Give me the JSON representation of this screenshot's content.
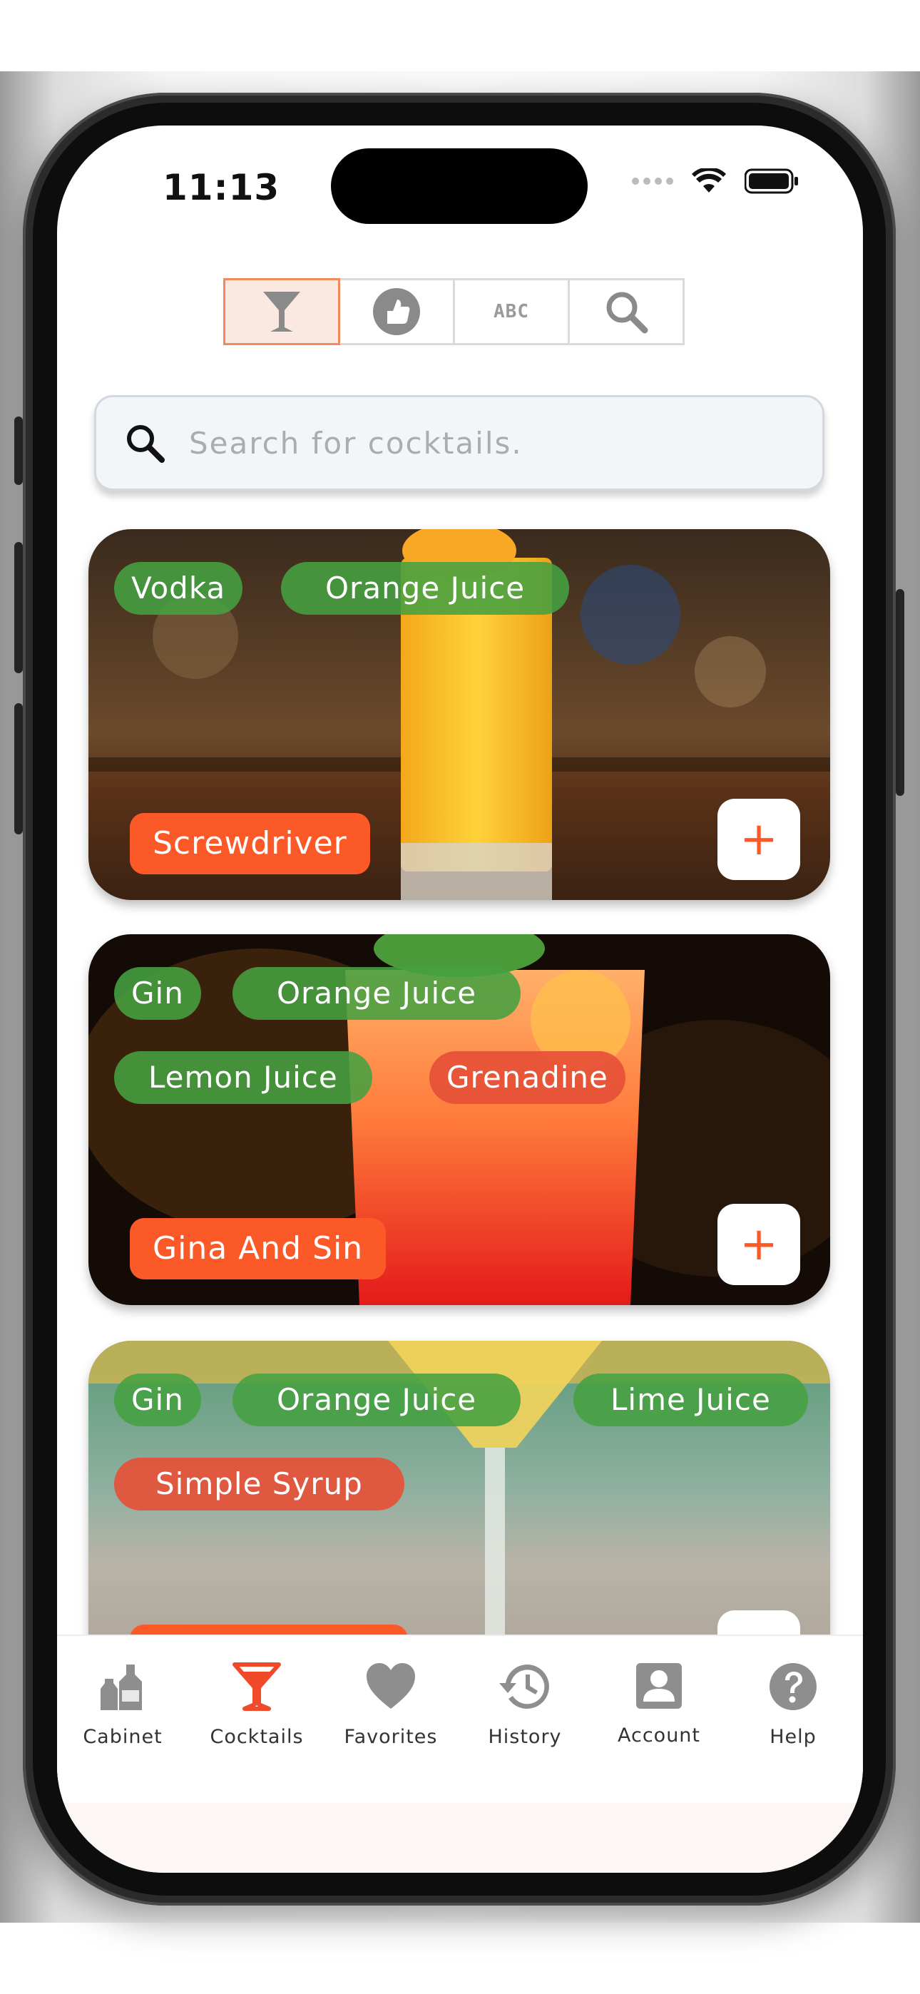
{
  "status": {
    "time": "11:13"
  },
  "segments": [
    {
      "name": "cocktail-filter",
      "icon": "cocktail-icon",
      "active": true
    },
    {
      "name": "favorites-filter",
      "icon": "thumb-icon",
      "active": false
    },
    {
      "name": "alpha-filter",
      "icon": "abc-icon",
      "label": "ABC",
      "active": false
    },
    {
      "name": "search-filter",
      "icon": "search-icon",
      "active": false
    }
  ],
  "search": {
    "placeholder": "Search for cocktails.",
    "value": ""
  },
  "cards": [
    {
      "name": "Screwdriver",
      "ingredients": [
        "Vodka",
        "Orange Juice"
      ],
      "add_label": "+"
    },
    {
      "name": "Gina And Sin",
      "ingredients": [
        "Gin",
        "Orange Juice",
        "Lemon Juice",
        "Grenadine"
      ],
      "add_label": "+"
    },
    {
      "name": "",
      "ingredients": [
        "Gin",
        "Orange Juice",
        "Lime Juice",
        "Simple Syrup"
      ],
      "add_label": "+"
    }
  ],
  "tabs": [
    {
      "label": "Cabinet",
      "icon": "bottles-icon",
      "active": false
    },
    {
      "label": "Cocktails",
      "icon": "cocktail-icon",
      "active": true
    },
    {
      "label": "Favorites",
      "icon": "heart-icon",
      "active": false
    },
    {
      "label": "History",
      "icon": "history-icon",
      "active": false
    },
    {
      "label": "Account",
      "icon": "account-icon",
      "active": false
    },
    {
      "label": "Help",
      "icon": "help-icon",
      "active": false
    }
  ],
  "colors": {
    "accent": "#fb5a28",
    "chip_green": "#46a041",
    "chip_red": "#e65037",
    "tab_active": "#f04a2a",
    "tab_inactive": "#8e8e8e"
  }
}
